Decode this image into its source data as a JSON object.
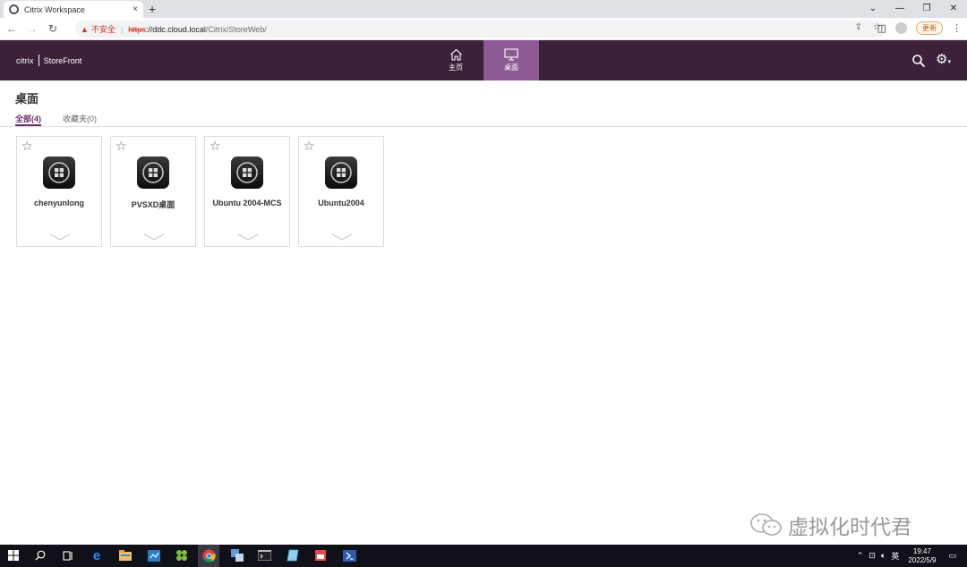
{
  "browser": {
    "tab_title": "Citrix Workspace",
    "tab_close": "×",
    "new_tab": "+",
    "win_min": "—",
    "win_max": "❐",
    "win_close": "✕",
    "nav_back": "←",
    "nav_forward": "→",
    "nav_reload": "↻",
    "insecure_label": "不安全",
    "url_scheme": "https",
    "url_host": "://ddc.cloud.local",
    "url_path": "/Citrix/StoreWeb/",
    "update_label": "更新"
  },
  "header": {
    "brand_citrix": "citrix",
    "brand_product": "StoreFront",
    "nav": [
      {
        "label": "主页",
        "icon": "home-icon"
      },
      {
        "label": "桌面",
        "icon": "monitor-icon",
        "active": true
      }
    ]
  },
  "page": {
    "title": "桌面",
    "filters": [
      {
        "label": "全部(4)",
        "active": true
      },
      {
        "label": "收藏夹(0)",
        "active": false
      }
    ],
    "tiles": [
      {
        "name": "chenyunlong"
      },
      {
        "name": "PVSXD桌面"
      },
      {
        "name": "Ubuntu 2004-MCS"
      },
      {
        "name": "Ubuntu2004"
      }
    ]
  },
  "watermark": "虚拟化时代君",
  "taskbar": {
    "time": "19:47",
    "date": "2022/5/9",
    "ime": "英"
  },
  "colors": {
    "header_bg": "#3b2238",
    "active_tab": "#8e5a96",
    "accent": "#6a2c6a"
  }
}
